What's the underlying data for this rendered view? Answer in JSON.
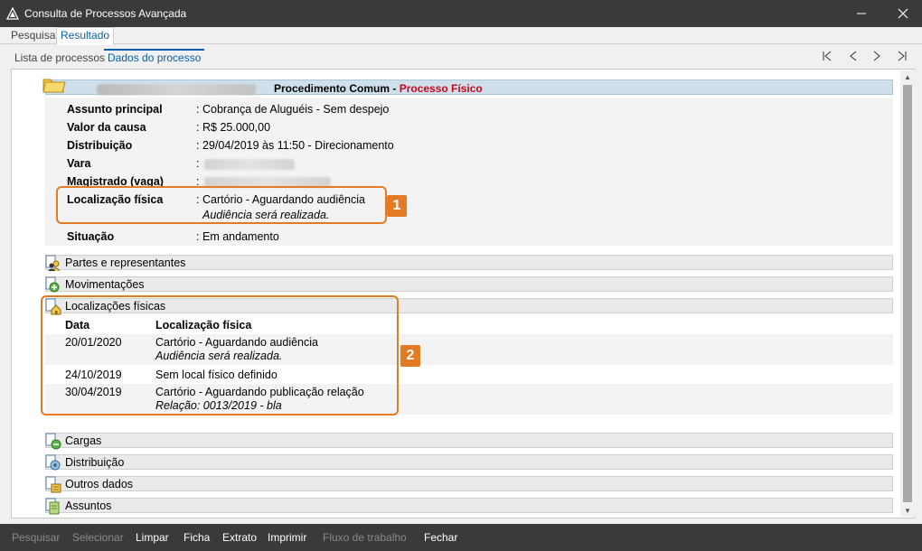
{
  "window": {
    "title": "Consulta de Processos Avançada"
  },
  "tabs_primary": [
    "Pesquisa",
    "Resultado"
  ],
  "tabs_secondary": [
    "Lista de processos",
    "Dados do processo"
  ],
  "process": {
    "type_prefix": "Procedimento Comum - ",
    "type_suffix": "Processo Físico",
    "fields": [
      {
        "label": "Assunto principal",
        "colon": ":",
        "value": "Cobrança de Aluguéis - Sem despejo"
      },
      {
        "label": "Valor da causa",
        "colon": ":",
        "value": "R$ 25.000,00"
      },
      {
        "label": "Distribuição",
        "colon": ":",
        "value": "29/04/2019 às 11:50 - Direcionamento"
      },
      {
        "label": "Vara",
        "colon": ":"
      },
      {
        "label": "Magistrado (vaga)",
        "colon": ":"
      },
      {
        "label": "Localização física",
        "colon": ":",
        "value": "Cartório - Aguardando audiência",
        "sub": "Audiência será realizada."
      },
      {
        "label": "Situação",
        "colon": ":",
        "value": "Em andamento"
      }
    ]
  },
  "sections": {
    "partes": "Partes e representantes",
    "movimentacoes": "Movimentações",
    "localizacoes": "Localizações físicas",
    "cargas": "Cargas",
    "distribuicao": "Distribuição",
    "outros": "Outros dados",
    "assuntos": "Assuntos"
  },
  "locations_table": {
    "headers": [
      "Data",
      "Localização física"
    ],
    "rows": [
      {
        "date": "20/01/2020",
        "desc": "Cartório - Aguardando audiência",
        "sub": "Audiência será realizada."
      },
      {
        "date": "24/10/2019",
        "desc": "Sem local físico definido"
      },
      {
        "date": "30/04/2019",
        "desc": "Cartório - Aguardando publicação relação",
        "sub": "Relação: 0013/2019 - bla"
      }
    ]
  },
  "callouts": [
    "1",
    "2"
  ],
  "footer": {
    "pesquisar": {
      "label": "Pesquisar",
      "enabled": false
    },
    "selecionar": {
      "label": "Selecionar",
      "enabled": false
    },
    "limpar": {
      "label": "Limpar",
      "enabled": true
    },
    "ficha": {
      "label": "Ficha",
      "enabled": true
    },
    "extrato": {
      "label": "Extrato",
      "enabled": true
    },
    "imprimir": {
      "label": "Imprimir",
      "enabled": true
    },
    "fluxo": {
      "label": "Fluxo de trabalho",
      "enabled": false
    },
    "fechar": {
      "label": "Fechar",
      "enabled": true
    }
  },
  "colors": {
    "titlebar": "#3a3a3a",
    "accent_tab": "#0c5ea8",
    "physical_red": "#d4001a",
    "callout_orange": "#e37b24",
    "header_blue": "#cfe0ea"
  },
  "icons": {
    "app": "app-logo-icon",
    "window_min": "minimize-icon",
    "window_close": "close-icon",
    "nav": [
      "first-page-icon",
      "previous-icon",
      "next-icon",
      "last-page-icon"
    ],
    "process": "folder-icon",
    "sections": [
      "people-icon",
      "movements-icon",
      "location-icon",
      "cargas-icon",
      "distribution-icon",
      "other-data-icon",
      "subjects-icon"
    ]
  }
}
